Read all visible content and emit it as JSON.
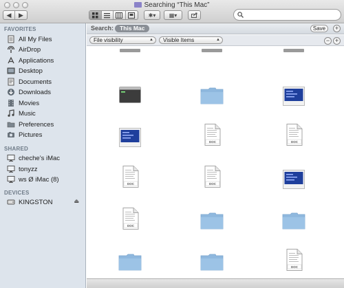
{
  "window": {
    "title": "Searching “This Mac”"
  },
  "toolbar": {
    "back_label": "◀",
    "forward_label": "▶",
    "views": [
      "icon-view",
      "list-view",
      "column-view",
      "coverflow-view"
    ],
    "action_label": "✱▾",
    "arrange_label": "▦▾",
    "share_icon": "share-icon"
  },
  "search": {
    "value": "",
    "placeholder": ""
  },
  "sidebar": {
    "favorites_heading": "FAVORITES",
    "favorites": [
      {
        "label": "All My Files",
        "icon": "all-files-icon"
      },
      {
        "label": "AirDrop",
        "icon": "airdrop-icon"
      },
      {
        "label": "Applications",
        "icon": "applications-icon"
      },
      {
        "label": "Desktop",
        "icon": "desktop-icon"
      },
      {
        "label": "Documents",
        "icon": "documents-icon"
      },
      {
        "label": "Downloads",
        "icon": "downloads-icon"
      },
      {
        "label": "Movies",
        "icon": "movies-icon"
      },
      {
        "label": "Music",
        "icon": "music-icon"
      },
      {
        "label": "Preferences",
        "icon": "folder-icon"
      },
      {
        "label": "Pictures",
        "icon": "pictures-icon"
      }
    ],
    "shared_heading": "SHARED",
    "shared": [
      {
        "label": "cheche’s iMac",
        "icon": "display-icon"
      },
      {
        "label": "tonyzz",
        "icon": "display-icon"
      },
      {
        "label": "ws Ø iMac (8)",
        "icon": "display-icon"
      }
    ],
    "devices_heading": "DEVICES",
    "devices": [
      {
        "label": "KINGSTON",
        "icon": "drive-icon",
        "eject": "⏏"
      }
    ]
  },
  "scope": {
    "label": "Search:",
    "selected": "This Mac",
    "save_label": "Save"
  },
  "criteria": {
    "attribute": "File visibility",
    "value": "Visible Items",
    "remove": "−",
    "add": "+"
  },
  "colors": {
    "sidebar_bg": "#dde4ec",
    "folder_blue": "#8fb8de",
    "scope_pill": "#8a8f96"
  },
  "icons": [
    "partial-icon",
    "partial-icon",
    "partial-icon",
    "terminal-icon",
    "folder-icon",
    "screenshot-icon",
    "screenshot-icon",
    "doc-icon",
    "doc-icon",
    "doc-icon",
    "doc-icon",
    "screenshot-icon",
    "doc-icon",
    "folder-icon",
    "folder-icon",
    "folder-icon",
    "folder-icon",
    "doc-icon"
  ],
  "doc_badge": "DOC"
}
